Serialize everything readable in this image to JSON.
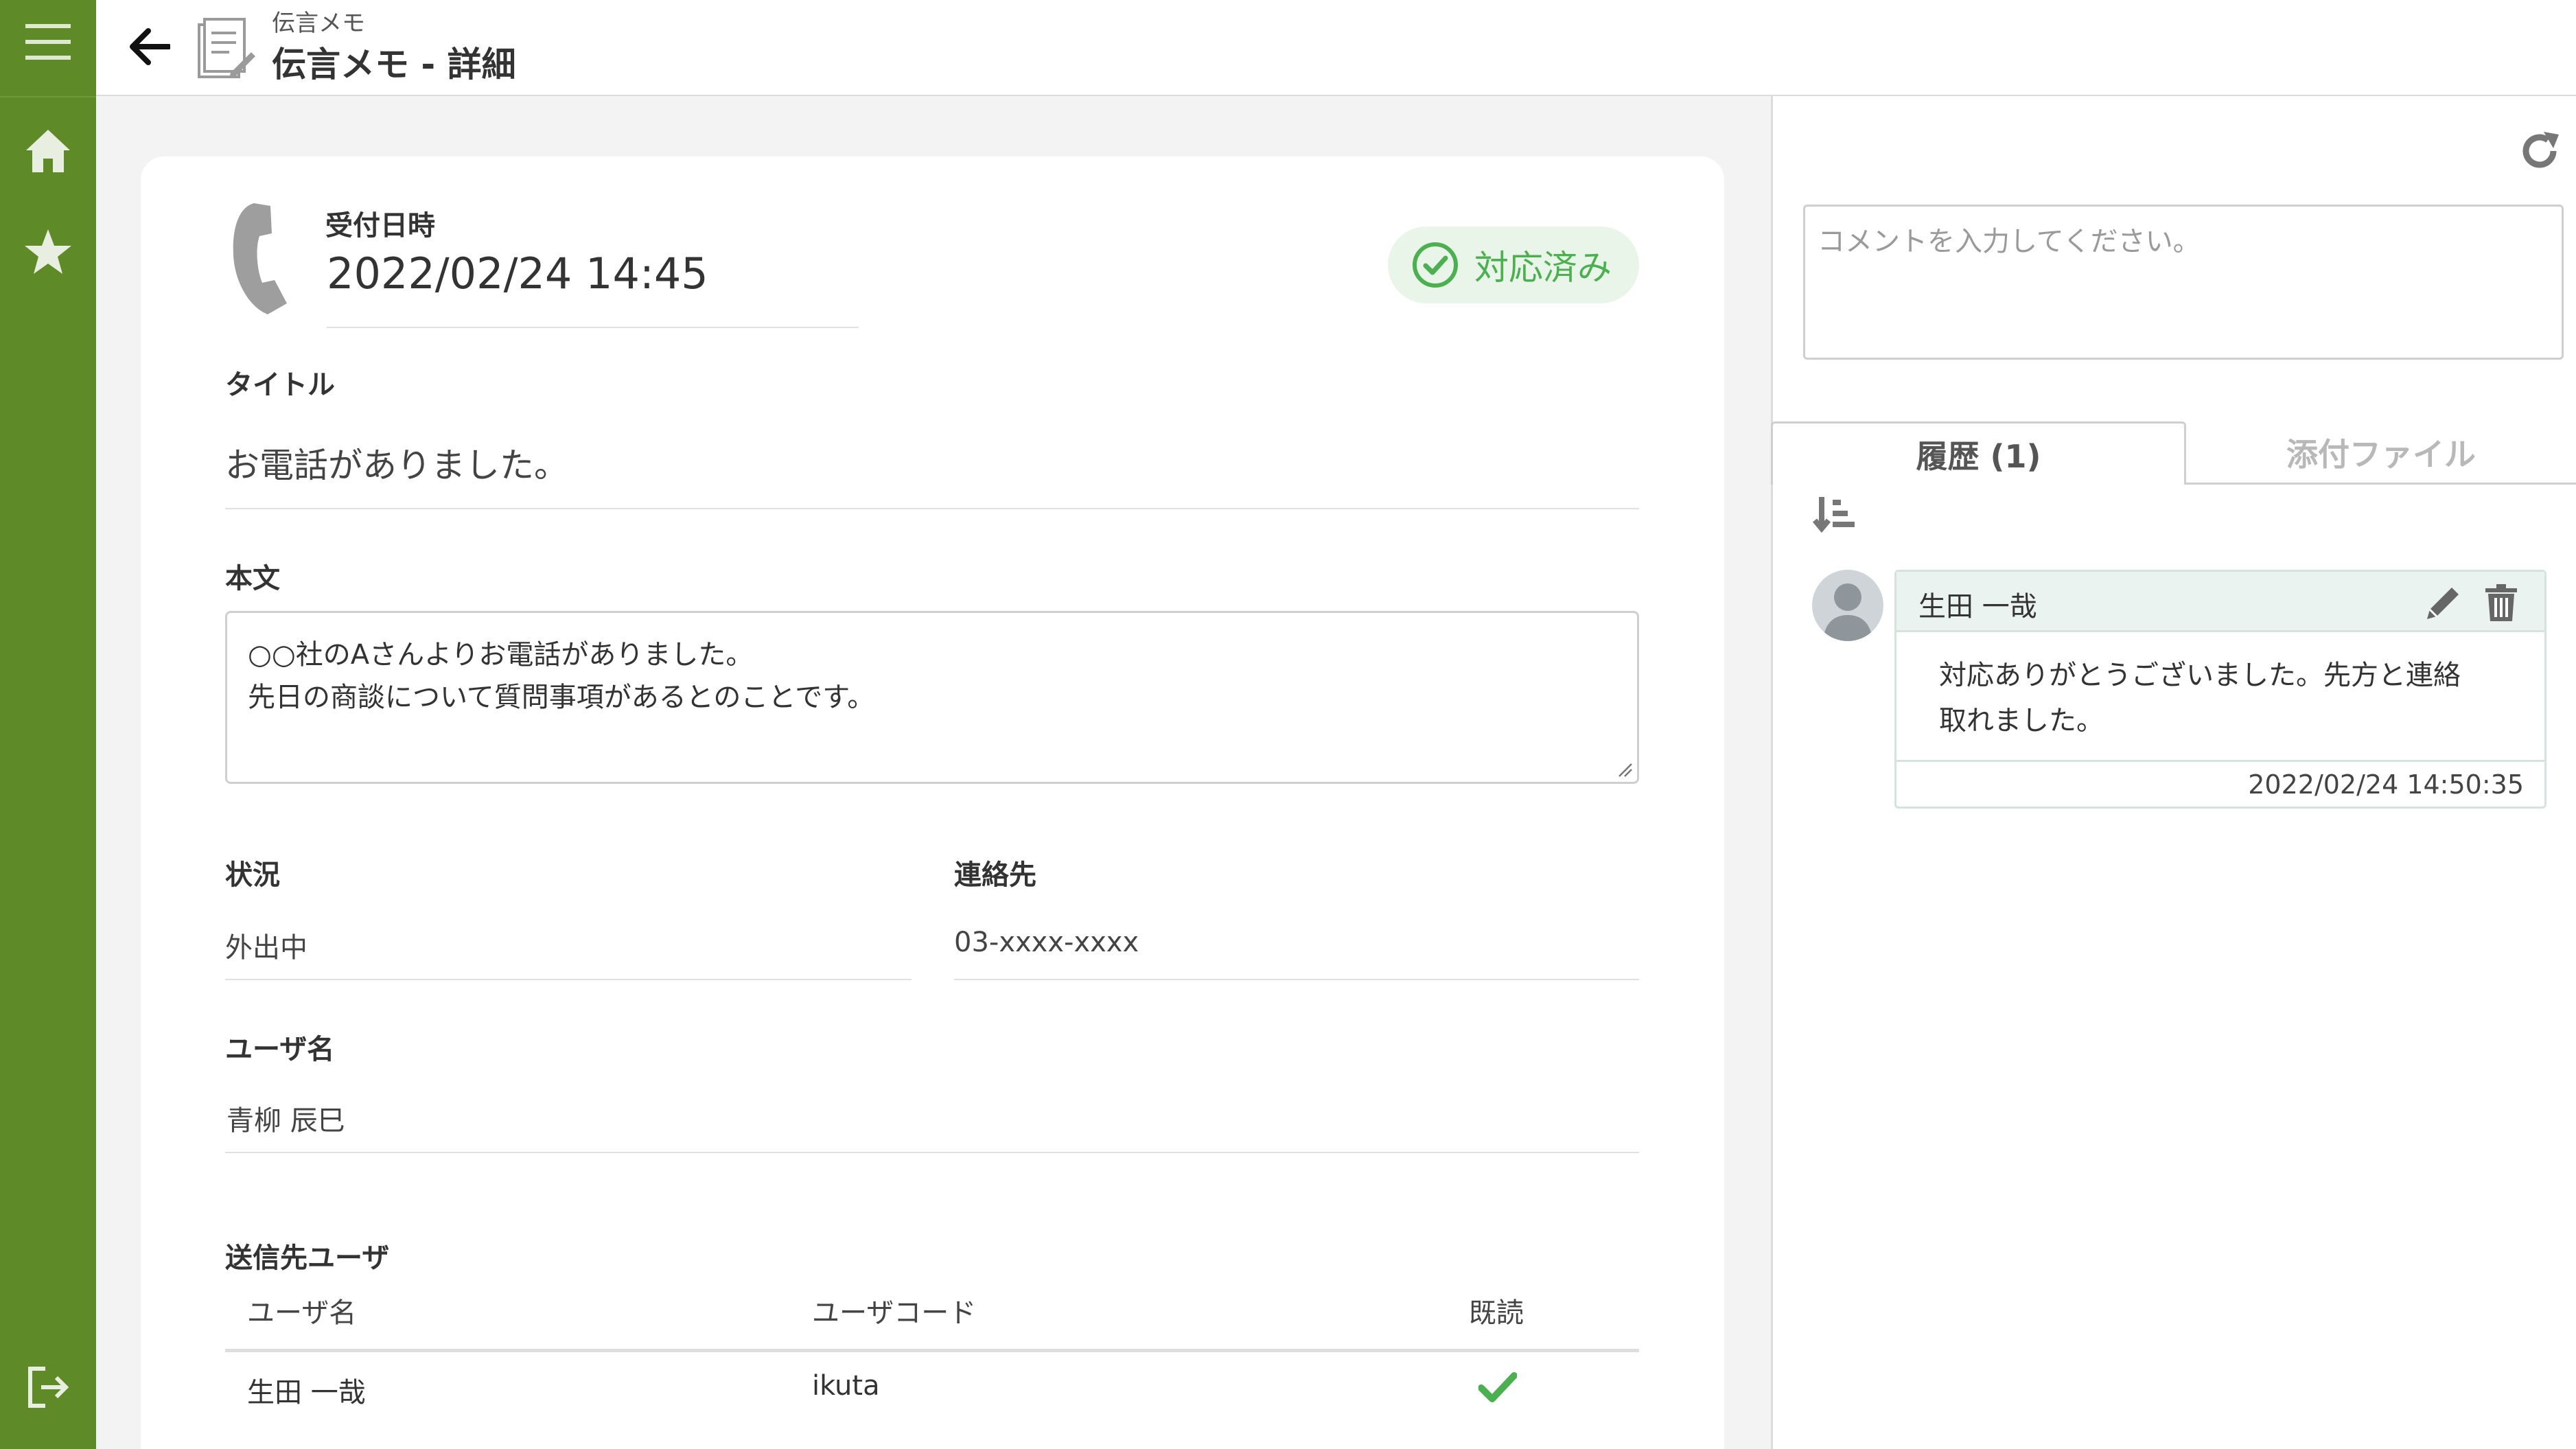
{
  "header": {
    "breadcrumb": "伝言メモ",
    "title": "伝言メモ - 詳細"
  },
  "memo": {
    "received_label": "受付日時",
    "received_value": "2022/02/24 14:45",
    "status": "対応済み",
    "title_label": "タイトル",
    "title_value": "お電話がありました。",
    "body_label": "本文",
    "body_lines": [
      "○○社のAさんよりお電話がありました。",
      "先日の商談について質問事項があるとのことです。"
    ],
    "situation_label": "状況",
    "situation_value": "外出中",
    "contact_label": "連絡先",
    "contact_value": "03-xxxx-xxxx",
    "username_label": "ユーザ名",
    "username_value": "青柳 辰巳",
    "recipients_label": "送信先ユーザ",
    "recipients_columns": [
      "ユーザ名",
      "ユーザコード",
      "既読"
    ],
    "recipients": [
      {
        "name": "生田 一哉",
        "code": "ikuta",
        "read": true
      }
    ]
  },
  "comments": {
    "placeholder": "コメントを入力してください。",
    "tabs": [
      "履歴 (1)",
      "添付ファイル"
    ],
    "history": [
      {
        "author": "生田 一哉",
        "lines": [
          "対応ありがとうございました。先方と連絡",
          "取れました。"
        ],
        "timestamp": "2022/02/24 14:50:35"
      }
    ]
  },
  "colors": {
    "sidebar": "#5f8a28",
    "status_green": "#4caf50",
    "status_bg": "#eaf5ea"
  },
  "icons": [
    "menu-icon",
    "home-icon",
    "star-icon",
    "logout-icon",
    "back-arrow-icon",
    "memo-document-icon",
    "phone-icon",
    "check-circle-icon",
    "refresh-icon",
    "sort-icon",
    "user-avatar-icon",
    "pencil-icon",
    "trash-icon",
    "checkmark-icon"
  ]
}
